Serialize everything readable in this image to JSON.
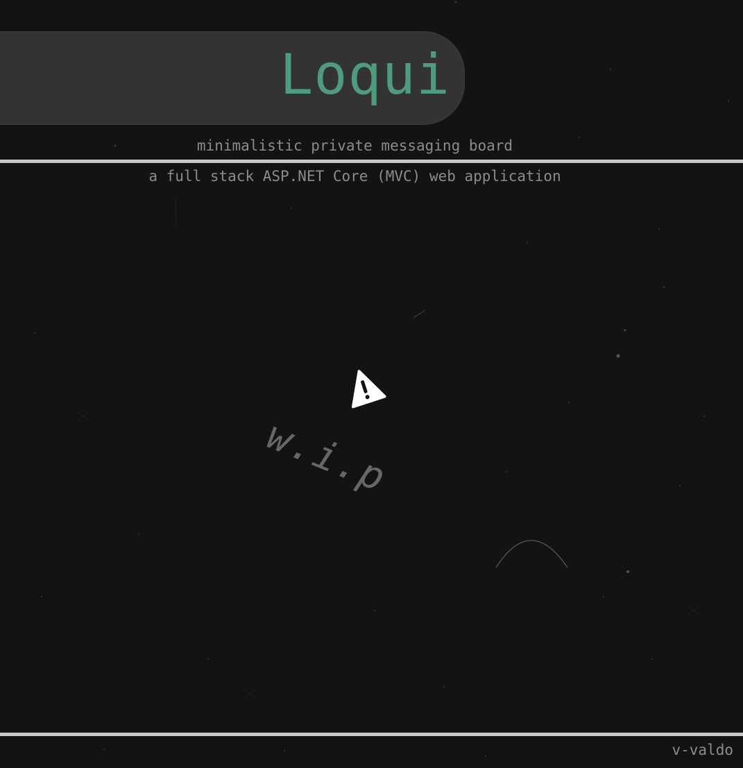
{
  "header": {
    "title": "Loqui",
    "subtitle": "minimalistic private messaging board"
  },
  "main": {
    "tagline": "a full stack ASP.NET Core (MVC) web application",
    "status_text": "w.i.p",
    "status_icon": "warning-icon"
  },
  "footer": {
    "author": "v-valdo"
  },
  "colors": {
    "background": "#131313",
    "accent": "#4f9b7e",
    "pill": "#333333",
    "muted_text": "#8c8c8c",
    "rule": "#c8c8c8"
  }
}
